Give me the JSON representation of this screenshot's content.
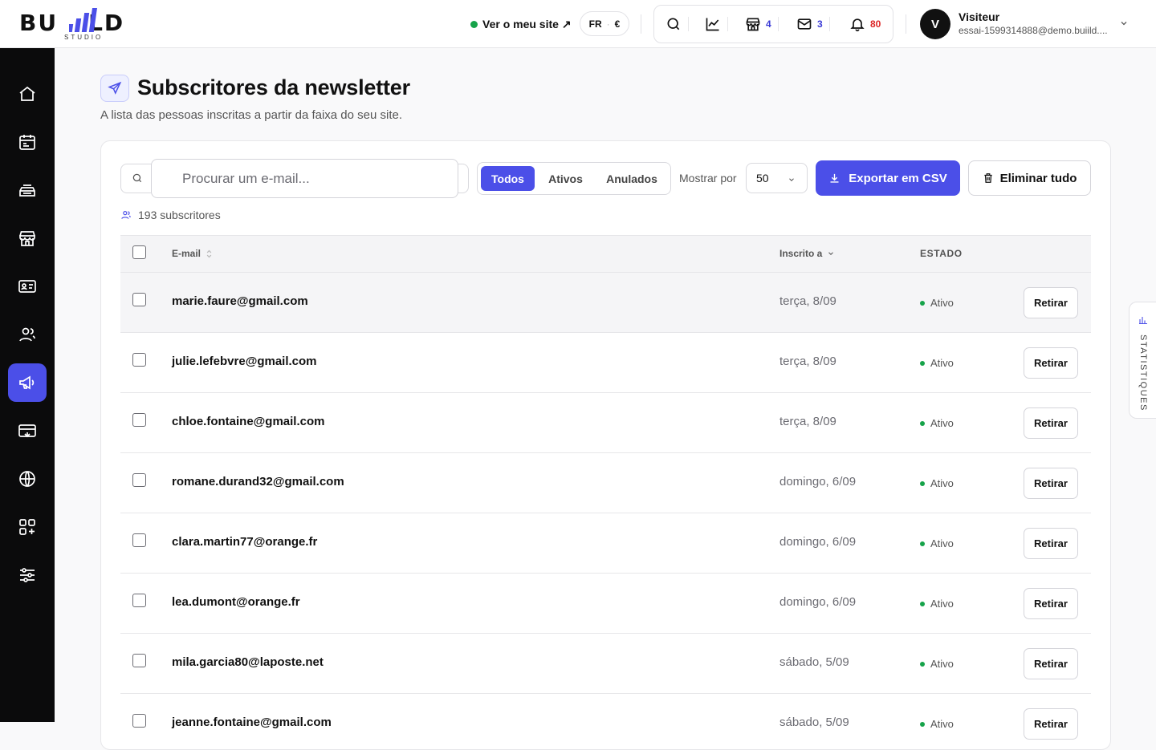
{
  "brand": {
    "logo_main_left": "BU",
    "logo_main_right": "LD",
    "logo_sub": "STUDIO",
    "accent": "#4b4fe8"
  },
  "header": {
    "site_link": "Ver o meu site ↗",
    "lang": "FR",
    "currency": "€",
    "tools": [
      {
        "icon": "search-icon"
      },
      {
        "icon": "chart-icon"
      },
      {
        "icon": "store-icon",
        "count": "4"
      },
      {
        "icon": "mail-icon",
        "count": "3"
      },
      {
        "icon": "bell-icon",
        "count": "80"
      }
    ],
    "user": {
      "initial": "V",
      "name": "Visiteur",
      "email": "essai-1599314888@demo.buiild...."
    }
  },
  "sidebar": {
    "items": [
      {
        "name": "home-icon"
      },
      {
        "name": "calendar-icon"
      },
      {
        "name": "tray-icon"
      },
      {
        "name": "store-icon"
      },
      {
        "name": "contact-card-icon"
      },
      {
        "name": "users-icon"
      },
      {
        "name": "megaphone-icon",
        "active": true
      },
      {
        "name": "payment-card-icon"
      },
      {
        "name": "globe-icon"
      },
      {
        "name": "apps-icon"
      },
      {
        "name": "sliders-icon"
      }
    ]
  },
  "page": {
    "title": "Subscritores da newsletter",
    "subtitle": "A lista das pessoas inscritas a partir da faixa do seu site."
  },
  "toolbar": {
    "search_placeholder": "Procurar um e-mail...",
    "filters": [
      "Todos",
      "Ativos",
      "Anulados"
    ],
    "active_filter": "Todos",
    "show_label": "Mostrar por",
    "show_value": "50",
    "export_label": "Exportar em CSV",
    "delete_label": "Eliminar tudo"
  },
  "count_text": "193 subscritores",
  "table": {
    "headers": {
      "email": "E-mail",
      "date": "Inscrito a",
      "status": "ESTADO"
    },
    "remove_label": "Retirar",
    "rows": [
      {
        "email": "marie.faure@gmail.com",
        "date": "terça, 8/09",
        "status": "Ativo"
      },
      {
        "email": "julie.lefebvre@gmail.com",
        "date": "terça, 8/09",
        "status": "Ativo"
      },
      {
        "email": "chloe.fontaine@gmail.com",
        "date": "terça, 8/09",
        "status": "Ativo"
      },
      {
        "email": "romane.durand32@gmail.com",
        "date": "domingo, 6/09",
        "status": "Ativo"
      },
      {
        "email": "clara.martin77@orange.fr",
        "date": "domingo, 6/09",
        "status": "Ativo"
      },
      {
        "email": "lea.dumont@orange.fr",
        "date": "domingo, 6/09",
        "status": "Ativo"
      },
      {
        "email": "mila.garcia80@laposte.net",
        "date": "sábado, 5/09",
        "status": "Ativo"
      },
      {
        "email": "jeanne.fontaine@gmail.com",
        "date": "sábado, 5/09",
        "status": "Ativo"
      }
    ]
  },
  "stats_tab": "STATISTIQUES"
}
